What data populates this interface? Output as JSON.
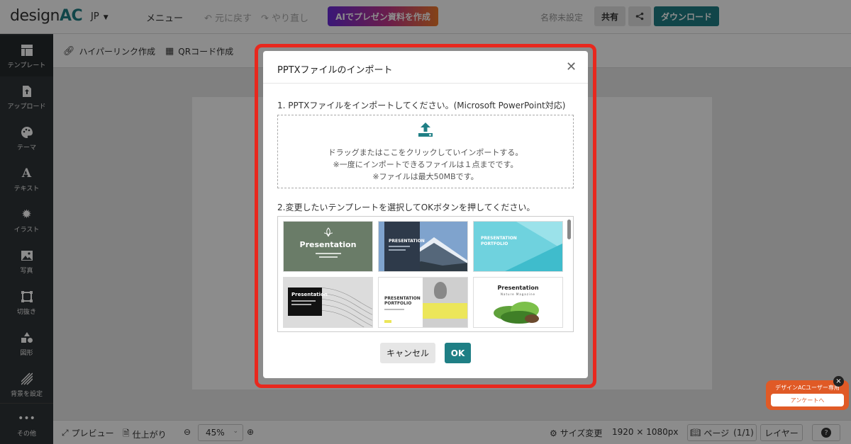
{
  "header": {
    "logo_prefix": "design",
    "logo_suffix": "AC",
    "language": "JP",
    "menu_label": "メニュー",
    "undo_label": "元に戻す",
    "redo_label": "やり直し",
    "ai_button_label": "AIでプレゼン資料を作成",
    "document_name": "名称未設定",
    "share_label": "共有",
    "download_label": "ダウンロード"
  },
  "sidebar": {
    "items": [
      {
        "label": "テンプレート",
        "icon": "template-icon"
      },
      {
        "label": "アップロード",
        "icon": "upload-file-icon"
      },
      {
        "label": "テーマ",
        "icon": "palette-icon"
      },
      {
        "label": "テキスト",
        "icon": "text-icon"
      },
      {
        "label": "イラスト",
        "icon": "gear-illustration-icon"
      },
      {
        "label": "写真",
        "icon": "photo-icon"
      },
      {
        "label": "切抜き",
        "icon": "crop-icon"
      },
      {
        "label": "図形",
        "icon": "shapes-icon"
      },
      {
        "label": "背景を設定",
        "icon": "background-icon"
      },
      {
        "label": "その他",
        "icon": "more-icon"
      }
    ]
  },
  "subtoolbar": {
    "hyperlink_label": "ハイパーリンク作成",
    "qr_label": "QRコード作成"
  },
  "bottombar": {
    "preview_label": "プレビュー",
    "finish_label": "仕上がり",
    "zoom_value": "45%",
    "size_change_label": "サイズ変更",
    "size_value": "1920 × 1080px",
    "page_label": "ページ",
    "page_count": "(1/1)",
    "layer_label": "レイヤー",
    "help_label": "?"
  },
  "modal": {
    "title": "PPTXファイルのインポート",
    "step1": "1. PPTXファイルをインポートしてください。(Microsoft PowerPoint対応)",
    "drop_line1": "ドラッグまたはここをクリックしていインポートする。",
    "drop_line2": "※一度にインポートできるファイルは１点までです。",
    "drop_line3": "※ファイルは最大50MBです。",
    "step2": "2.変更したいテンプレートを選択してOKボタンを押してください。",
    "templates": [
      {
        "title": "Presentation"
      },
      {
        "title": "PRESENTATION"
      },
      {
        "title": "PRESENTATION",
        "subtitle": "PORTFOLIO"
      },
      {
        "title": "Presentation"
      },
      {
        "title": "PRESENTATION",
        "subtitle": "PORTFOLIO"
      },
      {
        "title": "Presentation",
        "subtitle": "Nature Magazine"
      }
    ],
    "cancel_label": "キャンセル",
    "ok_label": "OK"
  },
  "survey": {
    "title": "デザインACユーザー専用",
    "button_label": "アンケートへ",
    "close_label": "×"
  },
  "colors": {
    "accent": "#1f7f85",
    "sidebar": "#2f3337",
    "highlight": "#e8281e",
    "survey": "#e05a26"
  }
}
